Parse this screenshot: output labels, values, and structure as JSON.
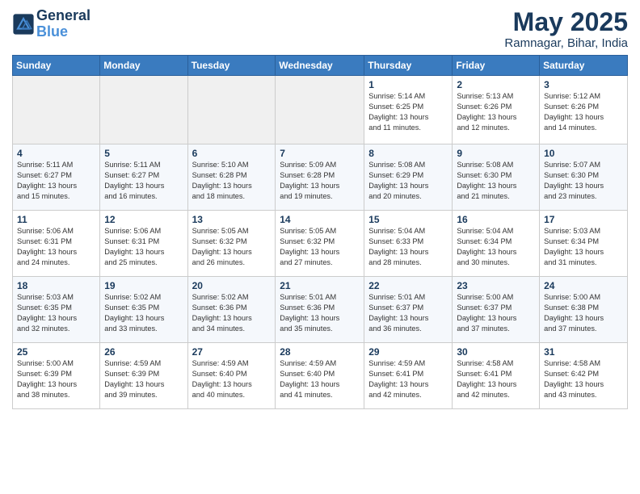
{
  "logo": {
    "line1": "General",
    "line2": "Blue"
  },
  "title": "May 2025",
  "subtitle": "Ramnagar, Bihar, India",
  "days_of_week": [
    "Sunday",
    "Monday",
    "Tuesday",
    "Wednesday",
    "Thursday",
    "Friday",
    "Saturday"
  ],
  "weeks": [
    [
      {
        "day": "",
        "info": ""
      },
      {
        "day": "",
        "info": ""
      },
      {
        "day": "",
        "info": ""
      },
      {
        "day": "",
        "info": ""
      },
      {
        "day": "1",
        "info": "Sunrise: 5:14 AM\nSunset: 6:25 PM\nDaylight: 13 hours\nand 11 minutes."
      },
      {
        "day": "2",
        "info": "Sunrise: 5:13 AM\nSunset: 6:26 PM\nDaylight: 13 hours\nand 12 minutes."
      },
      {
        "day": "3",
        "info": "Sunrise: 5:12 AM\nSunset: 6:26 PM\nDaylight: 13 hours\nand 14 minutes."
      }
    ],
    [
      {
        "day": "4",
        "info": "Sunrise: 5:11 AM\nSunset: 6:27 PM\nDaylight: 13 hours\nand 15 minutes."
      },
      {
        "day": "5",
        "info": "Sunrise: 5:11 AM\nSunset: 6:27 PM\nDaylight: 13 hours\nand 16 minutes."
      },
      {
        "day": "6",
        "info": "Sunrise: 5:10 AM\nSunset: 6:28 PM\nDaylight: 13 hours\nand 18 minutes."
      },
      {
        "day": "7",
        "info": "Sunrise: 5:09 AM\nSunset: 6:28 PM\nDaylight: 13 hours\nand 19 minutes."
      },
      {
        "day": "8",
        "info": "Sunrise: 5:08 AM\nSunset: 6:29 PM\nDaylight: 13 hours\nand 20 minutes."
      },
      {
        "day": "9",
        "info": "Sunrise: 5:08 AM\nSunset: 6:30 PM\nDaylight: 13 hours\nand 21 minutes."
      },
      {
        "day": "10",
        "info": "Sunrise: 5:07 AM\nSunset: 6:30 PM\nDaylight: 13 hours\nand 23 minutes."
      }
    ],
    [
      {
        "day": "11",
        "info": "Sunrise: 5:06 AM\nSunset: 6:31 PM\nDaylight: 13 hours\nand 24 minutes."
      },
      {
        "day": "12",
        "info": "Sunrise: 5:06 AM\nSunset: 6:31 PM\nDaylight: 13 hours\nand 25 minutes."
      },
      {
        "day": "13",
        "info": "Sunrise: 5:05 AM\nSunset: 6:32 PM\nDaylight: 13 hours\nand 26 minutes."
      },
      {
        "day": "14",
        "info": "Sunrise: 5:05 AM\nSunset: 6:32 PM\nDaylight: 13 hours\nand 27 minutes."
      },
      {
        "day": "15",
        "info": "Sunrise: 5:04 AM\nSunset: 6:33 PM\nDaylight: 13 hours\nand 28 minutes."
      },
      {
        "day": "16",
        "info": "Sunrise: 5:04 AM\nSunset: 6:34 PM\nDaylight: 13 hours\nand 30 minutes."
      },
      {
        "day": "17",
        "info": "Sunrise: 5:03 AM\nSunset: 6:34 PM\nDaylight: 13 hours\nand 31 minutes."
      }
    ],
    [
      {
        "day": "18",
        "info": "Sunrise: 5:03 AM\nSunset: 6:35 PM\nDaylight: 13 hours\nand 32 minutes."
      },
      {
        "day": "19",
        "info": "Sunrise: 5:02 AM\nSunset: 6:35 PM\nDaylight: 13 hours\nand 33 minutes."
      },
      {
        "day": "20",
        "info": "Sunrise: 5:02 AM\nSunset: 6:36 PM\nDaylight: 13 hours\nand 34 minutes."
      },
      {
        "day": "21",
        "info": "Sunrise: 5:01 AM\nSunset: 6:36 PM\nDaylight: 13 hours\nand 35 minutes."
      },
      {
        "day": "22",
        "info": "Sunrise: 5:01 AM\nSunset: 6:37 PM\nDaylight: 13 hours\nand 36 minutes."
      },
      {
        "day": "23",
        "info": "Sunrise: 5:00 AM\nSunset: 6:37 PM\nDaylight: 13 hours\nand 37 minutes."
      },
      {
        "day": "24",
        "info": "Sunrise: 5:00 AM\nSunset: 6:38 PM\nDaylight: 13 hours\nand 37 minutes."
      }
    ],
    [
      {
        "day": "25",
        "info": "Sunrise: 5:00 AM\nSunset: 6:39 PM\nDaylight: 13 hours\nand 38 minutes."
      },
      {
        "day": "26",
        "info": "Sunrise: 4:59 AM\nSunset: 6:39 PM\nDaylight: 13 hours\nand 39 minutes."
      },
      {
        "day": "27",
        "info": "Sunrise: 4:59 AM\nSunset: 6:40 PM\nDaylight: 13 hours\nand 40 minutes."
      },
      {
        "day": "28",
        "info": "Sunrise: 4:59 AM\nSunset: 6:40 PM\nDaylight: 13 hours\nand 41 minutes."
      },
      {
        "day": "29",
        "info": "Sunrise: 4:59 AM\nSunset: 6:41 PM\nDaylight: 13 hours\nand 42 minutes."
      },
      {
        "day": "30",
        "info": "Sunrise: 4:58 AM\nSunset: 6:41 PM\nDaylight: 13 hours\nand 42 minutes."
      },
      {
        "day": "31",
        "info": "Sunrise: 4:58 AM\nSunset: 6:42 PM\nDaylight: 13 hours\nand 43 minutes."
      }
    ]
  ]
}
